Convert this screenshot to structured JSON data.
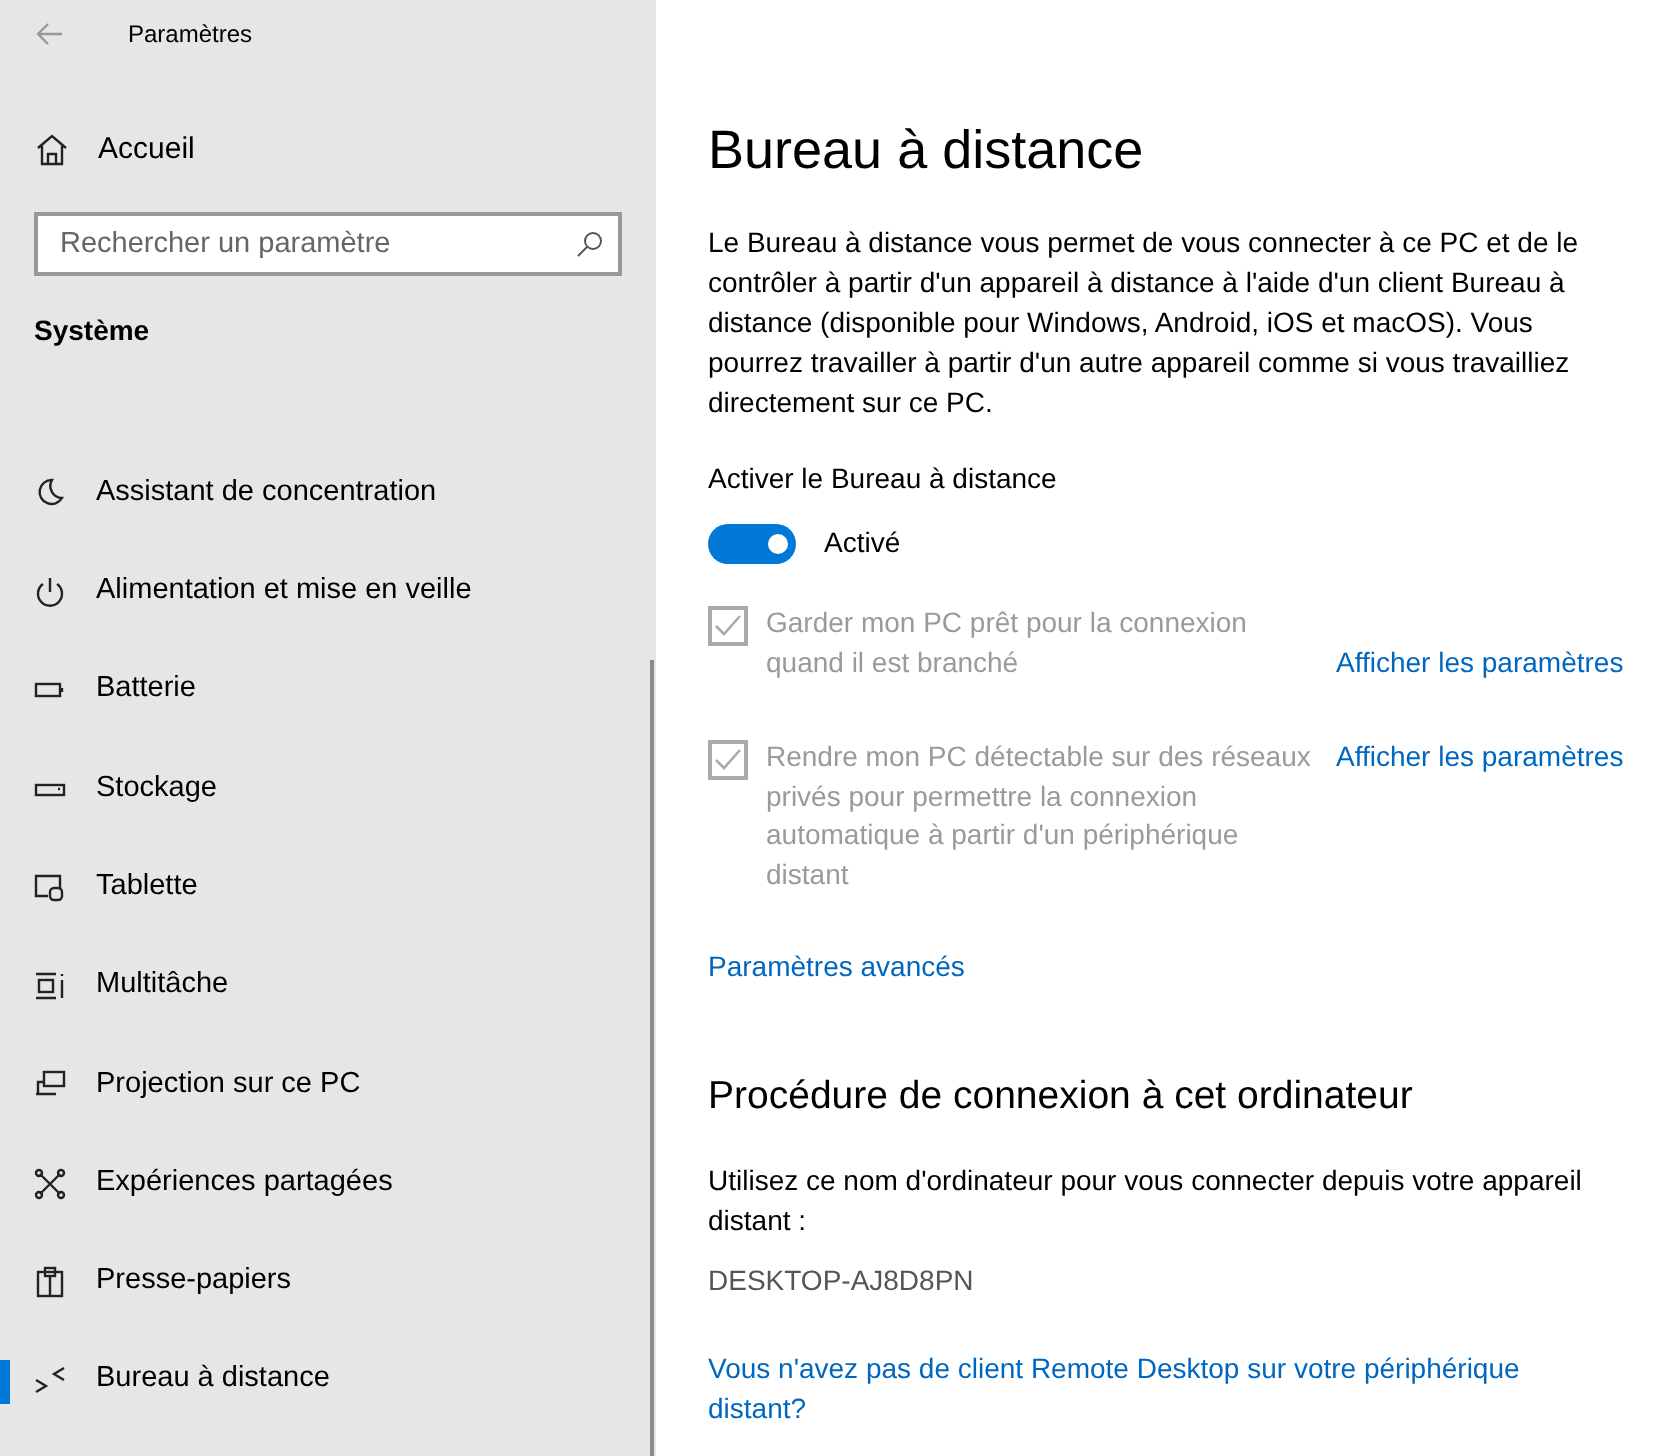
{
  "window": {
    "title": "Paramètres"
  },
  "sidebar": {
    "home": "Accueil",
    "search": {
      "placeholder": "Rechercher un paramètre"
    },
    "section": "Système",
    "items": [
      {
        "kind": "moon",
        "label": "Assistant de concentration",
        "selected": false
      },
      {
        "kind": "power",
        "label": "Alimentation et mise en veille",
        "selected": false
      },
      {
        "kind": "battery",
        "label": "Batterie",
        "selected": false
      },
      {
        "kind": "storage",
        "label": "Stockage",
        "selected": false
      },
      {
        "kind": "tablet",
        "label": "Tablette",
        "selected": false
      },
      {
        "kind": "multitask",
        "label": "Multitâche",
        "selected": false
      },
      {
        "kind": "projection",
        "label": "Projection sur ce PC",
        "selected": false
      },
      {
        "kind": "shared",
        "label": "Expériences partagées",
        "selected": false
      },
      {
        "kind": "clipboard",
        "label": "Presse-papiers",
        "selected": false
      },
      {
        "kind": "remote",
        "label": "Bureau à distance",
        "selected": true
      }
    ]
  },
  "main": {
    "title": "Bureau à distance",
    "description": "Le Bureau à distance vous permet de vous connecter à ce PC et de le contrôler à partir d'un appareil à distance à l'aide d'un client Bureau à distance (disponible pour Windows, Android, iOS et macOS). Vous pourrez travailler à partir d'un autre appareil comme si vous travailliez directement sur ce PC.",
    "toggle": {
      "label": "Activer le Bureau à distance",
      "on": true,
      "state_text": "Activé"
    },
    "options": [
      {
        "label": "Garder mon PC prêt pour la connexion quand il est branché",
        "checked": true,
        "disabled": true,
        "link": "Afficher les paramètres"
      },
      {
        "label": "Rendre mon PC détectable sur des réseaux privés pour permettre la connexion automatique à partir d'un périphérique distant",
        "checked": true,
        "disabled": true,
        "link": "Afficher les paramètres"
      }
    ],
    "advanced_link": "Paramètres avancés",
    "section_title": "Procédure de connexion à cet ordinateur",
    "section_text": "Utilisez ce nom d'ordinateur pour vous connecter depuis votre appareil distant :",
    "computer_name": "DESKTOP-AJ8D8PN",
    "bottom_link": "Vous n'avez pas de client Remote Desktop sur votre périphérique distant?"
  }
}
